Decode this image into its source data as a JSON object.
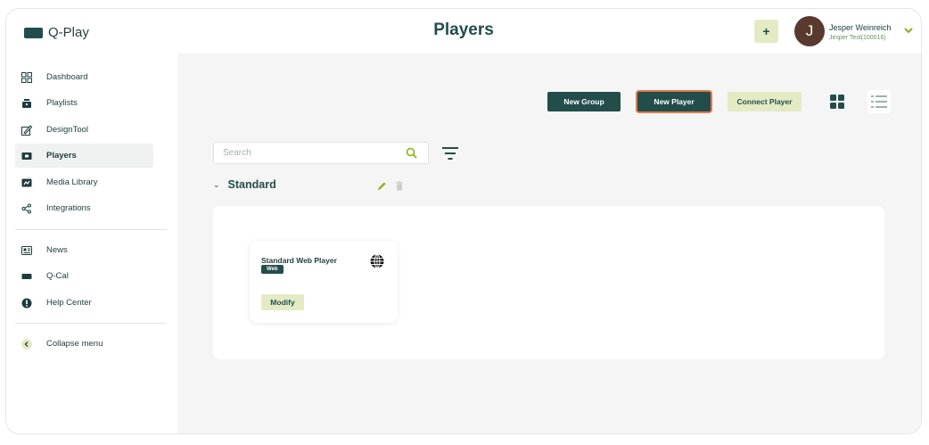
{
  "app": {
    "name": "Q-Play"
  },
  "header": {
    "title": "Players",
    "add_label": "+",
    "user": {
      "initial": "J",
      "name": "Jesper Weinreich",
      "org": "Jesper Test(100016)"
    }
  },
  "sidebar": {
    "items": [
      {
        "label": "Dashboard",
        "icon": "dashboard-grid-icon"
      },
      {
        "label": "Playlists",
        "icon": "playlist-icon"
      },
      {
        "label": "DesignTool",
        "icon": "design-tool-icon"
      },
      {
        "label": "Players",
        "icon": "player-icon",
        "active": true
      },
      {
        "label": "Media Library",
        "icon": "media-library-icon"
      },
      {
        "label": "Integrations",
        "icon": "share-nodes-icon"
      },
      {
        "label": "News",
        "icon": "news-icon"
      },
      {
        "label": "Q-Cal",
        "icon": "calendar-bar-icon"
      },
      {
        "label": "Help Center",
        "icon": "help-icon"
      },
      {
        "label": "Collapse menu",
        "icon": "chevron-left-circle-icon"
      }
    ]
  },
  "toolbar": {
    "new_group": "New Group",
    "new_player": "New Player",
    "connect_player": "Connect Player"
  },
  "search": {
    "placeholder": "Search",
    "value": ""
  },
  "group": {
    "title": "Standard",
    "players": [
      {
        "name": "Standard Web Player",
        "badge": "Web",
        "action": "Modify"
      }
    ]
  },
  "colors": {
    "brand_dark": "#234d4a",
    "accent_light": "#e4ebc4",
    "accent_green": "#8ab11c",
    "focus_ring": "#e07b4c",
    "avatar": "#5a3a2e"
  }
}
